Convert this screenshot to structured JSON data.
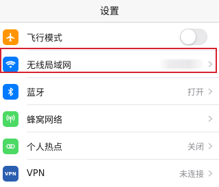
{
  "navbar": {
    "title": "设置"
  },
  "settings": [
    {
      "id": "airplane",
      "label": "飞行模式",
      "icon": "airplane-icon",
      "icon_color": "#ff9500",
      "control": "toggle",
      "toggle_on": false
    },
    {
      "id": "wlan",
      "label": "无线局域网",
      "icon": "wifi-icon",
      "icon_color": "#007aff",
      "control": "chevron",
      "value": ""
    },
    {
      "id": "bluetooth",
      "label": "蓝牙",
      "icon": "bluetooth-icon",
      "icon_color": "#007aff",
      "control": "chevron",
      "value": "打开"
    },
    {
      "id": "cellular",
      "label": "蜂窝网络",
      "icon": "cellular-icon",
      "icon_color": "#4cd964",
      "control": "chevron",
      "value": ""
    },
    {
      "id": "hotspot",
      "label": "个人热点",
      "icon": "hotspot-icon",
      "icon_color": "#4cd964",
      "control": "chevron",
      "value": "关闭"
    },
    {
      "id": "vpn",
      "label": "VPN",
      "icon": "vpn-icon",
      "icon_color": "#2a5fb0",
      "control": "chevron",
      "value": "未连接"
    }
  ],
  "highlight_color": "#d6202e"
}
